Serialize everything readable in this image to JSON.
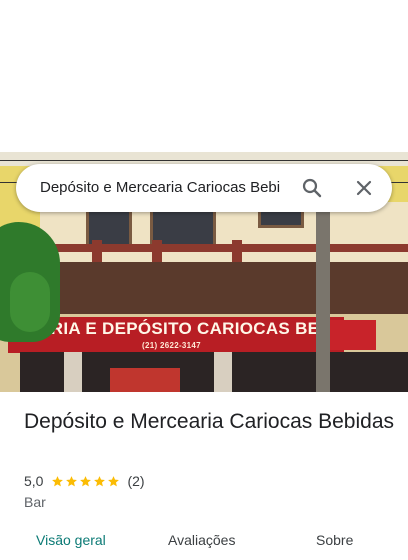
{
  "search": {
    "query": "Depósito e Mercearia Cariocas Bebi"
  },
  "photo": {
    "sign_text": "CEARIA E DEPÓSITO CARIOCAS BEBIDAS",
    "sign_phone": "(21) 2622-3147",
    "sign_color": "#b81e24"
  },
  "place": {
    "name": "Depósito e Mercearia Cariocas Bebidas",
    "rating": "5,0",
    "stars": 5,
    "review_count": "(2)",
    "category": "Bar"
  },
  "tabs": [
    {
      "label": "Visão geral",
      "active": true
    },
    {
      "label": "Avaliações",
      "active": false
    },
    {
      "label": "Sobre",
      "active": false
    }
  ],
  "colors": {
    "accent": "#0b7a75",
    "star": "#fbbc04"
  },
  "icons": {
    "search": "search-icon",
    "close": "close-icon"
  }
}
